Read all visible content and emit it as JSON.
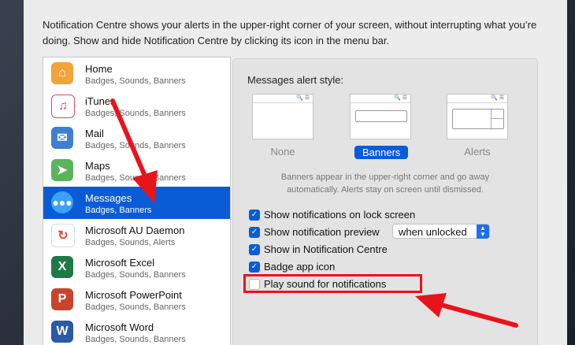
{
  "intro": "Notification Centre shows your alerts in the upper-right corner of your screen, without interrupting what you’re doing. Show and hide Notification Centre by clicking its icon in the menu bar.",
  "apps": [
    {
      "name": "Home",
      "sub": "Badges, Sounds, Banners",
      "icon": "home-icon",
      "color": "#f2a33a",
      "glyph": "⌂",
      "selected": false
    },
    {
      "name": "iTunes",
      "sub": "Badges, Sounds, Banners",
      "icon": "itunes-icon",
      "color": "#e6446b",
      "glyph": "♫",
      "selected": false
    },
    {
      "name": "Mail",
      "sub": "Badges, Sounds, Banners",
      "icon": "mail-icon",
      "color": "#3f7fcf",
      "glyph": "✉",
      "selected": false
    },
    {
      "name": "Maps",
      "sub": "Badges, Sounds, Banners",
      "icon": "maps-icon",
      "color": "#5bb45c",
      "glyph": "➤",
      "selected": false
    },
    {
      "name": "Messages",
      "sub": "Badges, Banners",
      "icon": "messages-icon",
      "color": "#3aa2f5",
      "glyph": "💬",
      "selected": true
    },
    {
      "name": "Microsoft AU Daemon",
      "sub": "Badges, Sounds, Alerts",
      "icon": "au-daemon-icon",
      "color": "#e2483c",
      "glyph": "↻",
      "selected": false
    },
    {
      "name": "Microsoft Excel",
      "sub": "Badges, Sounds, Banners",
      "icon": "excel-icon",
      "color": "#1d7a44",
      "glyph": "X",
      "selected": false
    },
    {
      "name": "Microsoft PowerPoint",
      "sub": "Badges, Sounds, Banners",
      "icon": "powerpoint-icon",
      "color": "#c9442a",
      "glyph": "P",
      "selected": false
    },
    {
      "name": "Microsoft Word",
      "sub": "Badges, Sounds, Banners",
      "icon": "word-icon",
      "color": "#2a5aa8",
      "glyph": "W",
      "selected": false
    }
  ],
  "panel": {
    "alert_style_title": "Messages alert style:",
    "styles": [
      "None",
      "Banners",
      "Alerts"
    ],
    "selected_style": "Banners",
    "description": "Banners appear in the upper-right corner and go away automatically. Alerts stay on screen until dismissed.",
    "options": [
      {
        "label": "Show notifications on lock screen",
        "checked": true
      },
      {
        "label": "Show notification preview",
        "checked": true
      },
      {
        "label": "Show in Notification Centre",
        "checked": true
      },
      {
        "label": "Badge app icon",
        "checked": true
      },
      {
        "label": "Play sound for notifications",
        "checked": false
      }
    ],
    "preview_select": "when unlocked"
  },
  "accent": "#0a5cd6",
  "annotation_color": "#e8141c"
}
